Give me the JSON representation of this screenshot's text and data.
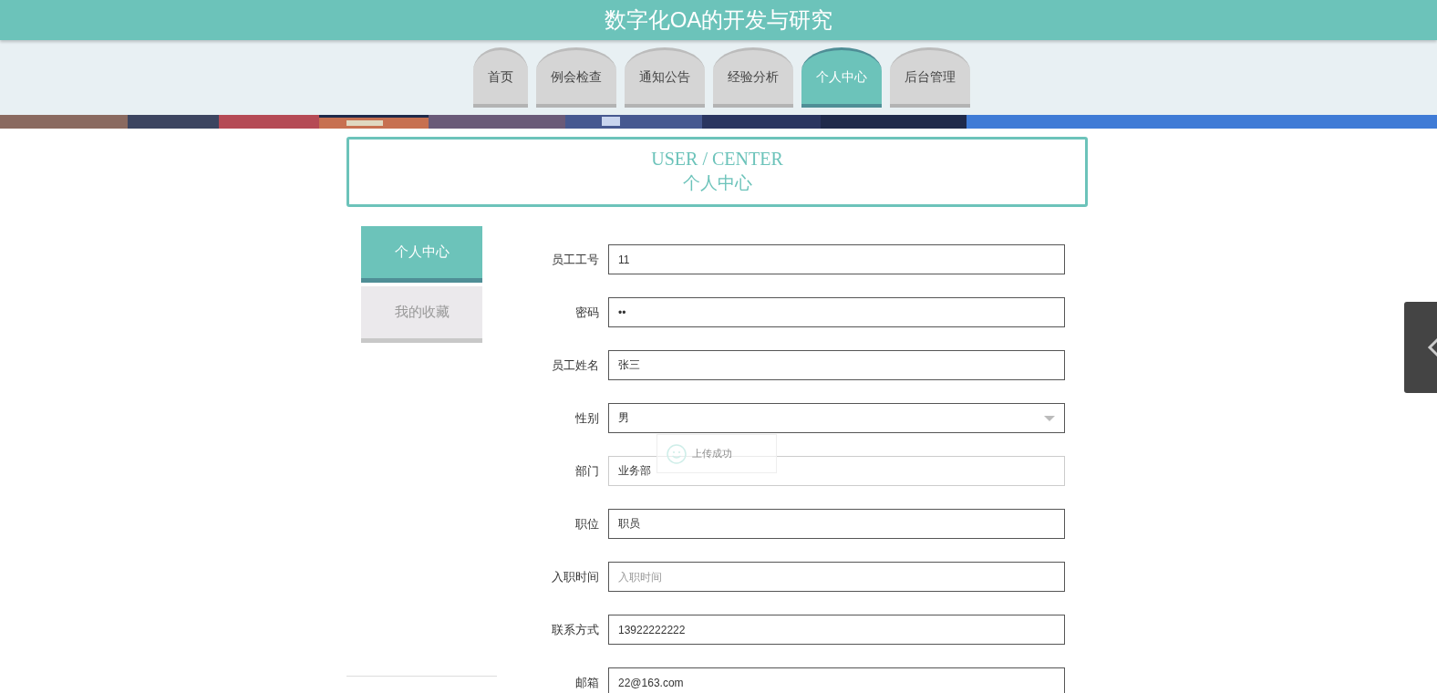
{
  "header": {
    "title": "数字化OA的开发与研究"
  },
  "nav": [
    {
      "label": "首页",
      "selected": false
    },
    {
      "label": "例会检查",
      "selected": false
    },
    {
      "label": "通知公告",
      "selected": false
    },
    {
      "label": "经验分析",
      "selected": false
    },
    {
      "label": "个人中心",
      "selected": true
    },
    {
      "label": "后台管理",
      "selected": false
    }
  ],
  "section_title": {
    "english": "USER / CENTER",
    "chinese": "个人中心"
  },
  "sidebar": [
    {
      "label": "个人中心",
      "selected": true
    },
    {
      "label": "我的收藏",
      "selected": false
    }
  ],
  "form": [
    {
      "label": "员工工号",
      "kind": "input",
      "value": "11"
    },
    {
      "label": "密码",
      "kind": "input",
      "value": "••"
    },
    {
      "label": "员工姓名",
      "kind": "input",
      "value": "张三"
    },
    {
      "label": "性别",
      "kind": "select",
      "value": "男"
    },
    {
      "label": "部门",
      "kind": "input",
      "value": "业务部"
    },
    {
      "label": "职位",
      "kind": "input",
      "value": "职员"
    },
    {
      "label": "入职时间",
      "kind": "input",
      "placeholder": "入职时间"
    },
    {
      "label": "联系方式",
      "kind": "input",
      "value": "13922222222"
    },
    {
      "label": "邮箱",
      "kind": "input",
      "value": "22@163.com"
    }
  ],
  "toast": {
    "message": "上传成功"
  }
}
